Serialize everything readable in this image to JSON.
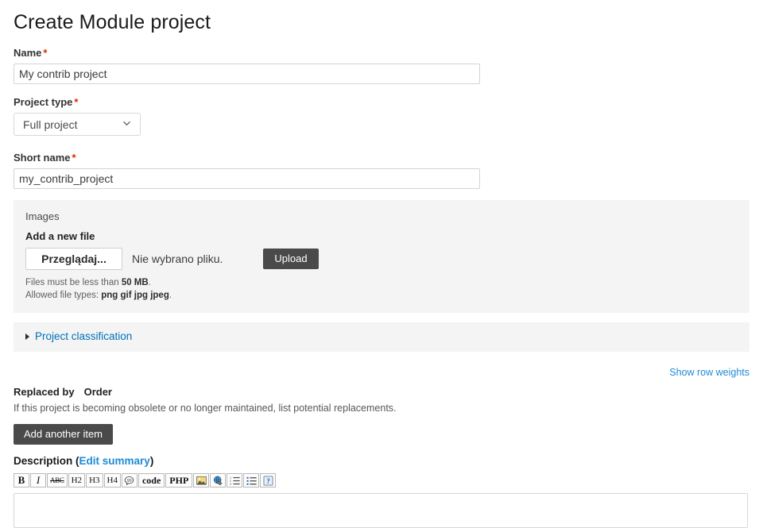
{
  "page": {
    "title": "Create Module project"
  },
  "fields": {
    "name": {
      "label": "Name",
      "required_marker": "*",
      "value": "My contrib project",
      "placeholder": ""
    },
    "project_type": {
      "label": "Project type",
      "required_marker": "*",
      "selected": "Full project",
      "options": [
        "Full project"
      ],
      "chevron_icon": "chevron-down-icon"
    },
    "short_name": {
      "label": "Short name",
      "required_marker": "*",
      "value": "my_contrib_project",
      "placeholder": ""
    }
  },
  "images": {
    "legend": "Images",
    "add_file_label": "Add a new file",
    "browse_button": "Przeglądaj...",
    "file_status": "Nie wybrano pliku.",
    "upload_button": "Upload",
    "hint_size_prefix": "Files must be less than ",
    "hint_size_value": "50 MB",
    "hint_size_suffix": ".",
    "hint_types_prefix": "Allowed file types: ",
    "hint_types_value": "png gif jpg jpeg",
    "hint_types_suffix": "."
  },
  "classification": {
    "summary_label": "Project classification",
    "triangle_icon": "triangle-right-icon",
    "expanded": false
  },
  "row_weights": {
    "label": "Show row weights"
  },
  "replaced_by": {
    "column_1": "Replaced by",
    "column_2": "Order",
    "description": "If this project is becoming obsolete or no longer maintained, list potential replacements.",
    "add_button": "Add another item"
  },
  "description": {
    "label": "Description",
    "open_paren": "(",
    "edit_summary_link": "Edit summary",
    "close_paren": ")",
    "textarea_value": "",
    "textarea_placeholder": "",
    "toolbar": [
      {
        "name": "bold-button",
        "kind": "text",
        "label": "B"
      },
      {
        "name": "italic-button",
        "kind": "text",
        "label": "I"
      },
      {
        "name": "strikethrough-button",
        "kind": "text",
        "label": "ABC"
      },
      {
        "name": "heading-2-button",
        "kind": "text",
        "label": "H2"
      },
      {
        "name": "heading-3-button",
        "kind": "text",
        "label": "H3"
      },
      {
        "name": "heading-4-button",
        "kind": "text",
        "label": "H4"
      },
      {
        "name": "blockquote-button",
        "kind": "icon",
        "label": "quote-bubble-icon"
      },
      {
        "name": "code-button",
        "kind": "text",
        "label": "code"
      },
      {
        "name": "php-button",
        "kind": "text",
        "label": "PHP"
      },
      {
        "name": "insert-image-button",
        "kind": "icon",
        "label": "image-icon"
      },
      {
        "name": "insert-link-button",
        "kind": "icon",
        "label": "globe-link-icon"
      },
      {
        "name": "ordered-list-button",
        "kind": "icon",
        "label": "ordered-list-icon"
      },
      {
        "name": "unordered-list-button",
        "kind": "icon",
        "label": "unordered-list-icon"
      },
      {
        "name": "help-button",
        "kind": "icon",
        "label": "question-mark-icon"
      }
    ]
  },
  "colors": {
    "required_asterisk": "#e32700",
    "link": "#1d8bd5",
    "collapse_link": "#0071b8",
    "button_dark": "#4a4a4a",
    "panel_background": "#f4f4f4",
    "input_border": "#d4d4d4",
    "text": "#333333"
  }
}
